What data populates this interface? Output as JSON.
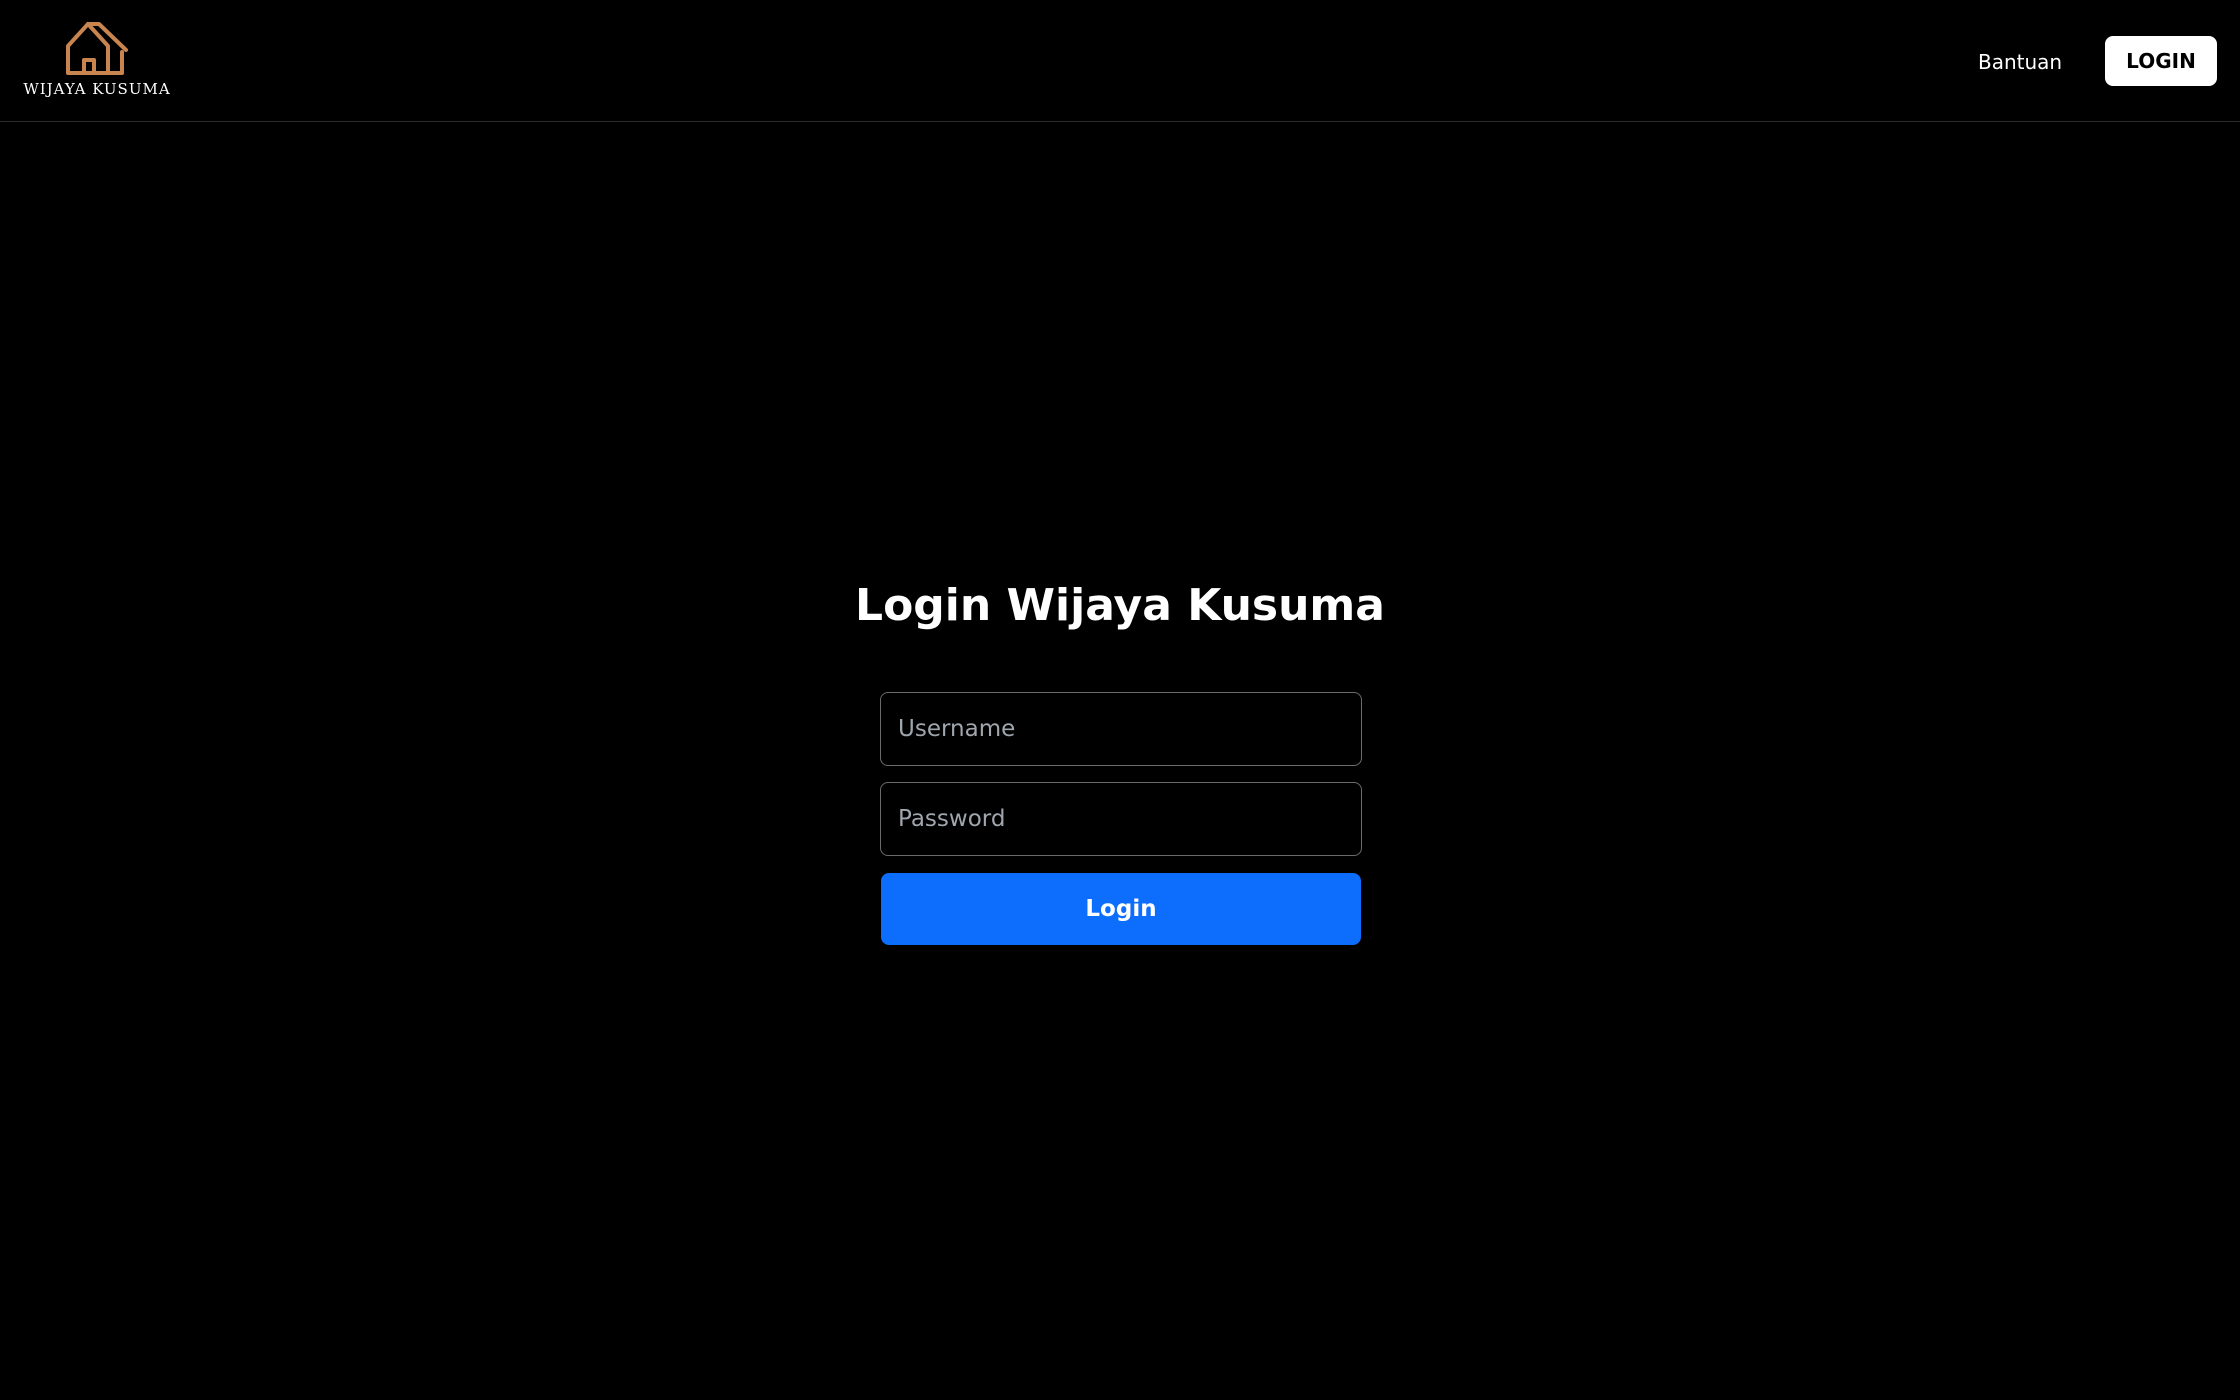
{
  "navbar": {
    "brand_name": "WIJAYA KUSUMA",
    "logo_icon": "house-outline-icon",
    "logo_color": "#c98550",
    "help_label": "Bantuan",
    "login_label": "LOGIN"
  },
  "login_form": {
    "title": "Login Wijaya Kusuma",
    "username_placeholder": "Username",
    "username_value": "",
    "password_placeholder": "Password",
    "password_value": "",
    "submit_label": "Login",
    "submit_color": "#0d6efd"
  },
  "colors": {
    "background": "#000000",
    "text": "#ffffff"
  }
}
